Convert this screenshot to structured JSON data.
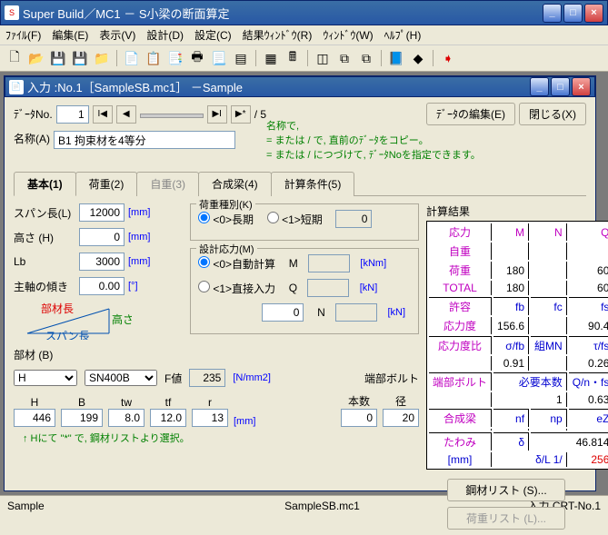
{
  "win": {
    "title": "Super Build／MC1 － S小梁の断面算定"
  },
  "menu": {
    "file": "ﾌｧｲﾙ(F)",
    "edit": "編集(E)",
    "view": "表示(V)",
    "design": "設計(D)",
    "setting": "設定(C)",
    "result": "結果ｳｨﾝﾄﾞｳ(R)",
    "window": "ｳｨﾝﾄﾞｳ(W)",
    "help": "ﾍﾙﾌﾟ(H)"
  },
  "child": {
    "title": "入力 :No.1［SampleSB.mc1］ －Sample"
  },
  "top": {
    "datano_lbl": "ﾃﾞｰﾀNo.",
    "datano": "1",
    "total": "/ 5",
    "name_lbl": "名称(A)",
    "name": "B1 拘束材を4等分",
    "edit_btn": "ﾃﾞｰﾀの編集(E)",
    "close_btn": "閉じる(X)",
    "hint1": "名称で,",
    "hint2": "= または / で, 直前のﾃﾞｰﾀをコピー。",
    "hint3": "= または / につづけて, ﾃﾞｰﾀNoを指定できます。"
  },
  "tabs": {
    "t1": "基本(1)",
    "t2": "荷重(2)",
    "t3": "自重(3)",
    "t4": "合成梁(4)",
    "t5": "計算条件(5)"
  },
  "form": {
    "span_lbl": "スパン長(L)",
    "span": "12000",
    "mm": "[mm]",
    "h_lbl": "高さ (H)",
    "h": "0",
    "lb_lbl": "Lb",
    "lb": "3000",
    "axis_lbl": "主軸の傾き",
    "axis": "0.00",
    "deg": "[°]",
    "diag1": "部材長",
    "diag2": "高さ",
    "diag3": "スパン長",
    "buzai_lbl": "部材 (B)",
    "shape": "H",
    "steel": "SN400B",
    "f_lbl": "F値",
    "f": "235",
    "nmm2": "[N/mm2]",
    "end_bolt": "端部ボルト",
    "count_lbl": "本数",
    "dia_lbl": "径",
    "count": "0",
    "dia": "20",
    "col_h": "H",
    "col_b": "B",
    "col_tw": "tw",
    "col_tf": "tf",
    "col_r": "r",
    "v_h": "446",
    "v_b": "199",
    "v_tw": "8.0",
    "v_tf": "12.0",
    "v_r": "13",
    "note": "↑ Hにて \"*\" で, 鋼材リストより選択。",
    "ld_title": "荷重種別(K)",
    "ld0": "<0>長期",
    "ld1": "<1>短期",
    "ld_v": "0",
    "st_title": "設計応力(M)",
    "st0": "<0>自動計算",
    "st1": "<1>直接入力",
    "M": "M",
    "Q": "Q",
    "N": "N",
    "knm": "[kNm]",
    "kn": "[kN]",
    "v0": "0"
  },
  "result": {
    "hd": "計算結果",
    "r1": "応力",
    "r2": "自重",
    "r3": "荷重",
    "r4": "TOTAL",
    "r5": "許容",
    "r6": "応力度",
    "r7": "応力度比",
    "r8": "端部ボルト",
    "r9": "合成梁",
    "r10": "たわみ",
    "M": "M",
    "N": "N",
    "Q": "Q",
    "fb": "fb",
    "fc": "fc",
    "fs": "fs",
    "stb": "σ/fb",
    "kmn": "組MN",
    "tfs": "τ/fs",
    "req": "必要本数",
    "qn": "Q/n・fs",
    "nf": "nf",
    "np": "np",
    "ez": "eZ",
    "d": "δ",
    "dl": "δ/L  1/",
    "mm": "[mm]",
    "v_j_m": "180",
    "v_j_q": "60",
    "v_t_m": "180",
    "v_t_q": "60",
    "v_fb": "156.6",
    "v_fs": "90.4",
    "v_stb": "0.91",
    "v_tfs": "0.26",
    "v_req": "1",
    "v_qn": "0.63",
    "v_d": "46.814",
    "v_dl": "256",
    "btn1": "鋼材リスト (S)...",
    "btn2": "荷重リスト (L)..."
  },
  "status": {
    "s1": "Sample",
    "s2": "SampleSB.mc1",
    "s3": "入力 CRT-No.1"
  }
}
